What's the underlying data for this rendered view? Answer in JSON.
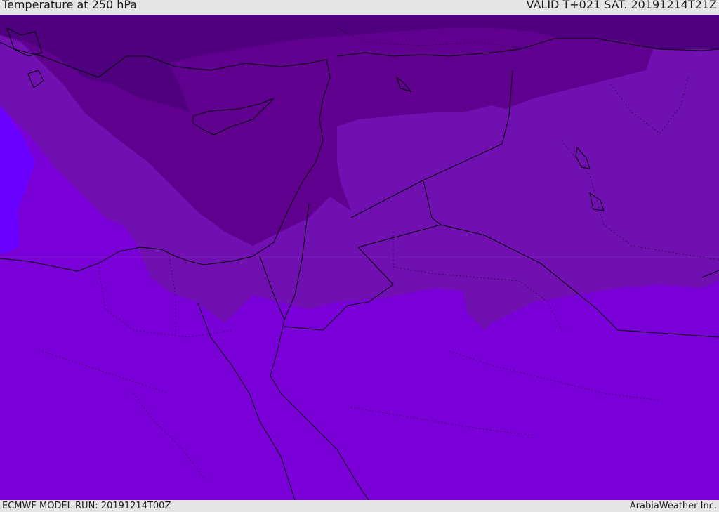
{
  "header": {
    "title": "Temperature at 250 hPa",
    "valid_time": "VALID T+021 SAT. 20191214T21Z"
  },
  "footer": {
    "model_run": "ECMWF MODEL RUN: 20191214T00Z",
    "credit": "ArabiaWeather Inc."
  },
  "map": {
    "colors": {
      "coldest": "#4f007f",
      "colder": "#60008f",
      "cold": "#7010b0",
      "mid": "#7a00d8",
      "warm": "#6a00ff",
      "coast_line": "#000000",
      "border_line": "#000000"
    }
  }
}
